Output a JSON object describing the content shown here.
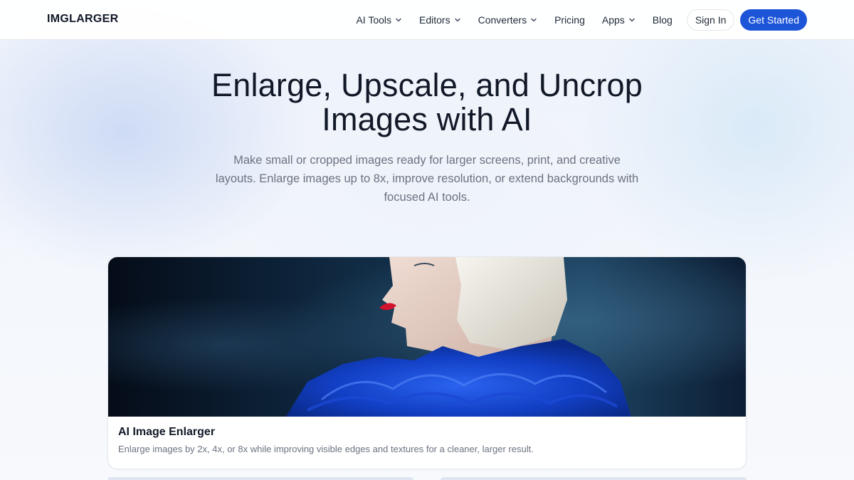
{
  "header": {
    "logo": "IMGLARGER",
    "nav": [
      {
        "label": "AI Tools",
        "dropdown": true
      },
      {
        "label": "Editors",
        "dropdown": true
      },
      {
        "label": "Converters",
        "dropdown": true
      },
      {
        "label": "Pricing",
        "dropdown": false
      },
      {
        "label": "Apps",
        "dropdown": true
      },
      {
        "label": "Blog",
        "dropdown": false
      }
    ],
    "sign_in": "Sign In",
    "get_started": "Get Started"
  },
  "hero": {
    "title_line1": "Enlarge, Upscale, and Uncrop",
    "title_line2": "Images with AI",
    "subtitle": "Make small or cropped images ready for larger screens, print, and creative layouts. Enlarge images up to 8x, improve resolution, or extend backgrounds with focused AI tools."
  },
  "feature_card": {
    "title": "AI Image Enlarger",
    "description": "Enlarge images by 2x, 4x, or 8x while improving visible edges and textures for a cleaner, larger result."
  },
  "colors": {
    "accent": "#1d55d9",
    "text": "#111827",
    "muted": "#6b7280"
  },
  "icons": {
    "dropdown": "chevron-down-icon"
  }
}
